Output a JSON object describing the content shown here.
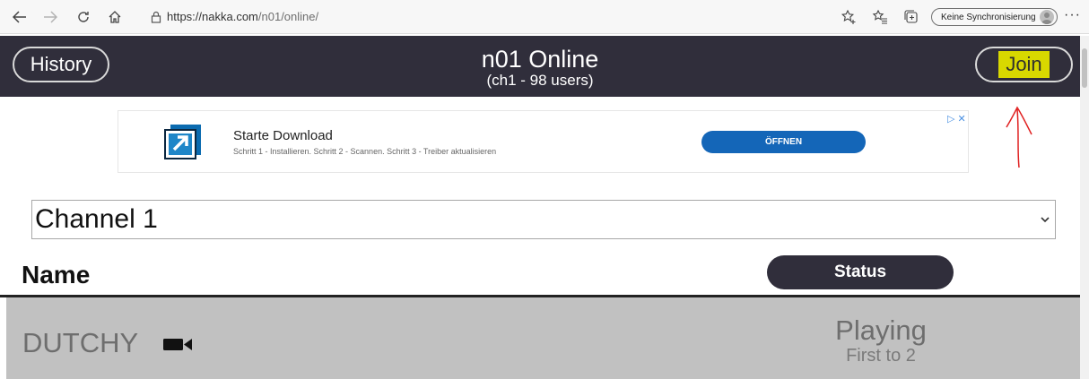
{
  "browser": {
    "url_domain": "https://nakka.com",
    "url_path": "/n01/online/",
    "sync_label": "Keine Synchronisierung",
    "more_label": "···"
  },
  "header": {
    "history_label": "History",
    "title": "n01 Online",
    "subtitle": "(ch1 - 98 users)",
    "join_label": "Join"
  },
  "ad": {
    "title": "Starte Download",
    "description": "Schritt 1 - Installieren. Schritt 2 - Scannen. Schritt 3 - Treiber aktualisieren",
    "button_label": "ÖFFNEN",
    "badge": "▷ ✕"
  },
  "channel": {
    "selected": "Channel 1"
  },
  "table": {
    "name_header": "Name",
    "status_header": "Status",
    "rows": [
      {
        "name": "DUTCHY",
        "status": "Playing",
        "substatus": "First to 2"
      }
    ]
  },
  "colors": {
    "header_bg": "#302e3b",
    "join_highlight": "#d8d800",
    "ad_button": "#1466b8",
    "row_bg": "#c1c1c1",
    "annotation": "#e02020"
  },
  "icons": [
    "back-icon",
    "forward-icon",
    "refresh-icon",
    "home-icon",
    "lock-icon",
    "favorite-add-icon",
    "favorites-icon",
    "collections-icon",
    "profile-icon",
    "more-icon",
    "ad-logo-icon",
    "chevron-down-icon",
    "video-camera-icon",
    "annotation-arrow-icon"
  ]
}
